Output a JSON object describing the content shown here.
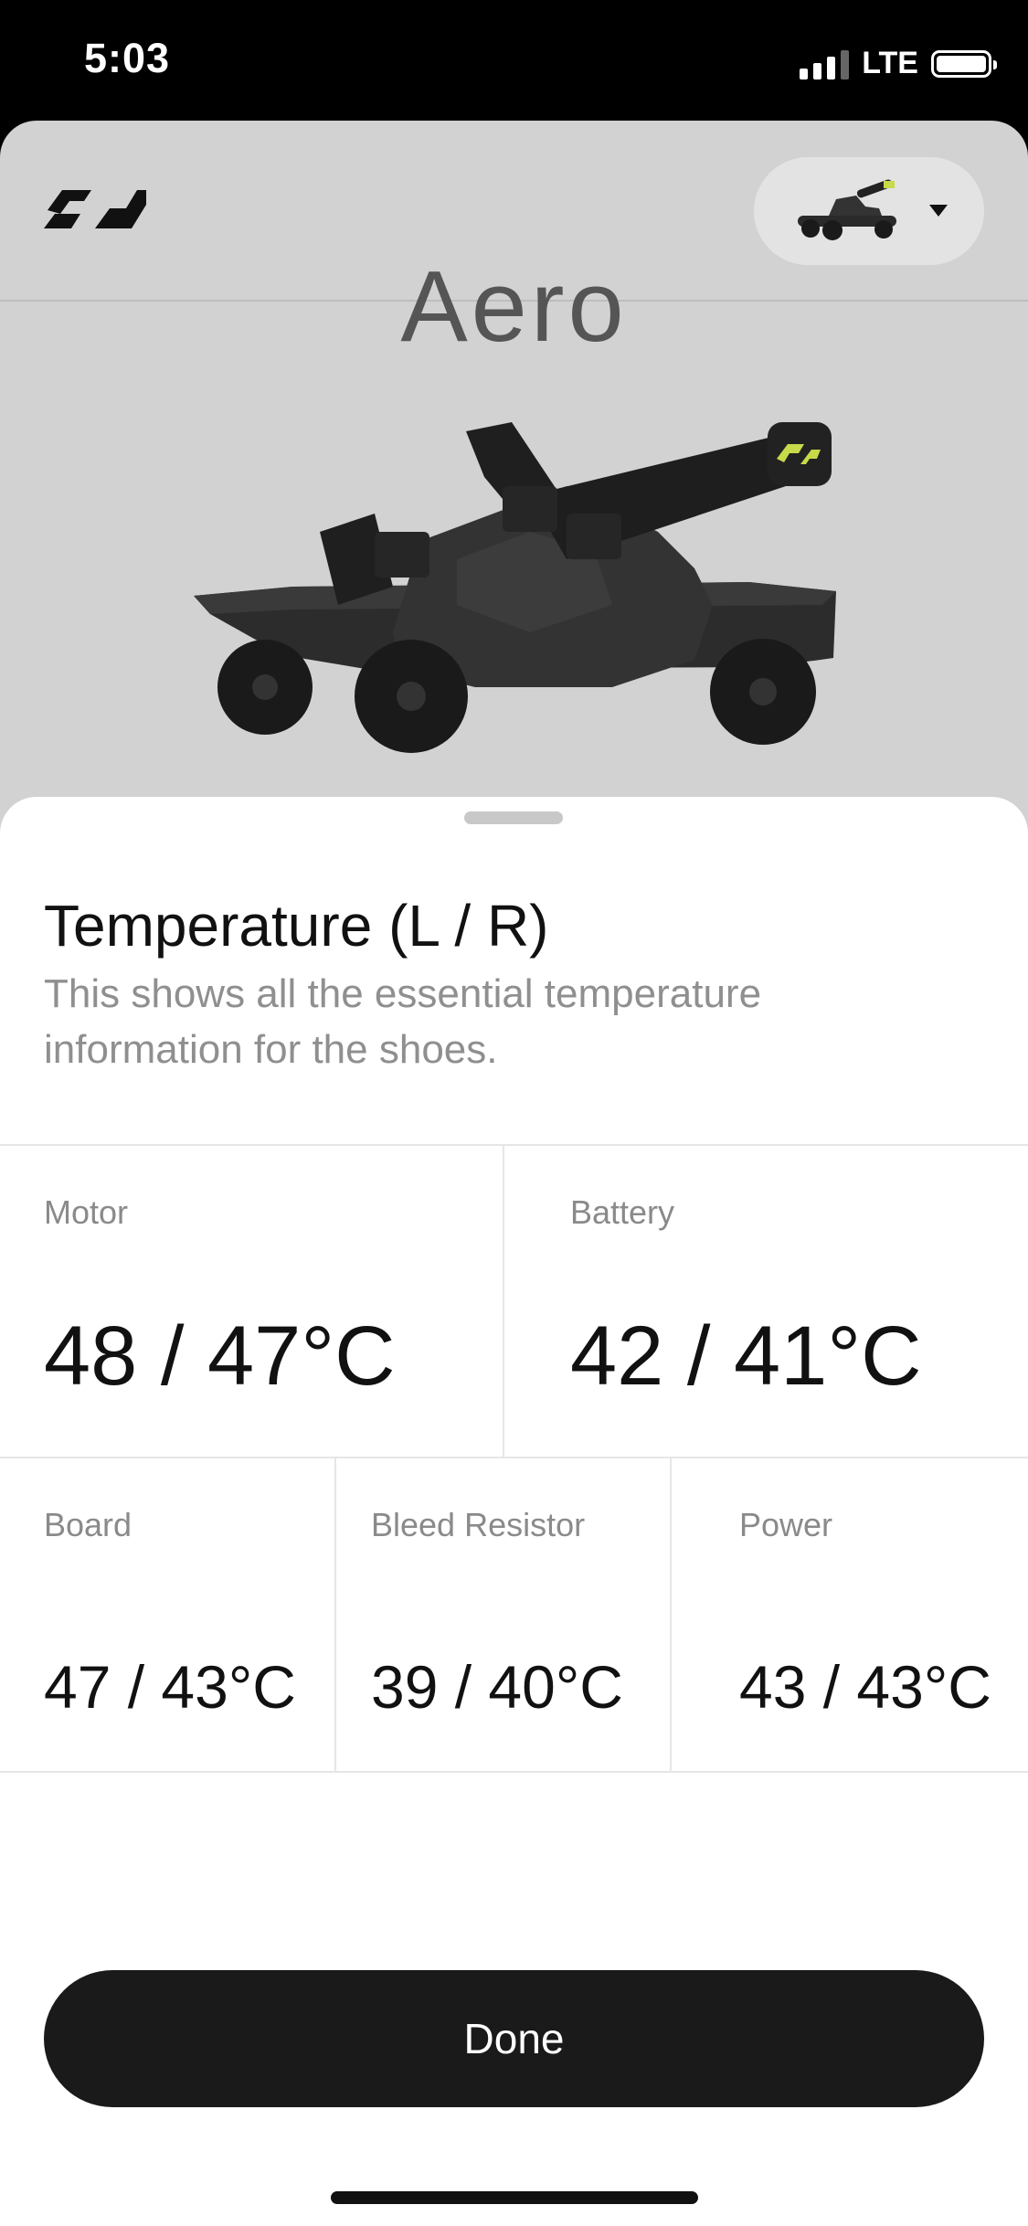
{
  "status_bar": {
    "time": "5:03",
    "network": "LTE"
  },
  "header": {
    "logo_icon": "brand-logo-icon",
    "device_selector": {
      "thumbnail": "skate-shoe-thumbnail",
      "icon": "chevron-down-icon"
    }
  },
  "product": {
    "name": "Aero",
    "image": "skate-shoe-image"
  },
  "sheet": {
    "title": "Temperature (L / R)",
    "description": "This shows all the essential temperature information for the shoes.",
    "metrics_top": [
      {
        "label": "Motor",
        "value": "48 / 47°C"
      },
      {
        "label": "Battery",
        "value": "42 / 41°C"
      }
    ],
    "metrics_bottom": [
      {
        "label": "Board",
        "value": "47 / 43°C"
      },
      {
        "label": "Bleed Resistor",
        "value": "39 / 40°C"
      },
      {
        "label": "Power",
        "value": "43 / 43°C"
      }
    ],
    "done_label": "Done"
  },
  "colors": {
    "background_card": "#d2d2d2",
    "sheet": "#ffffff",
    "primary_button": "#1a1a1a",
    "accent": "#c8d94a"
  }
}
